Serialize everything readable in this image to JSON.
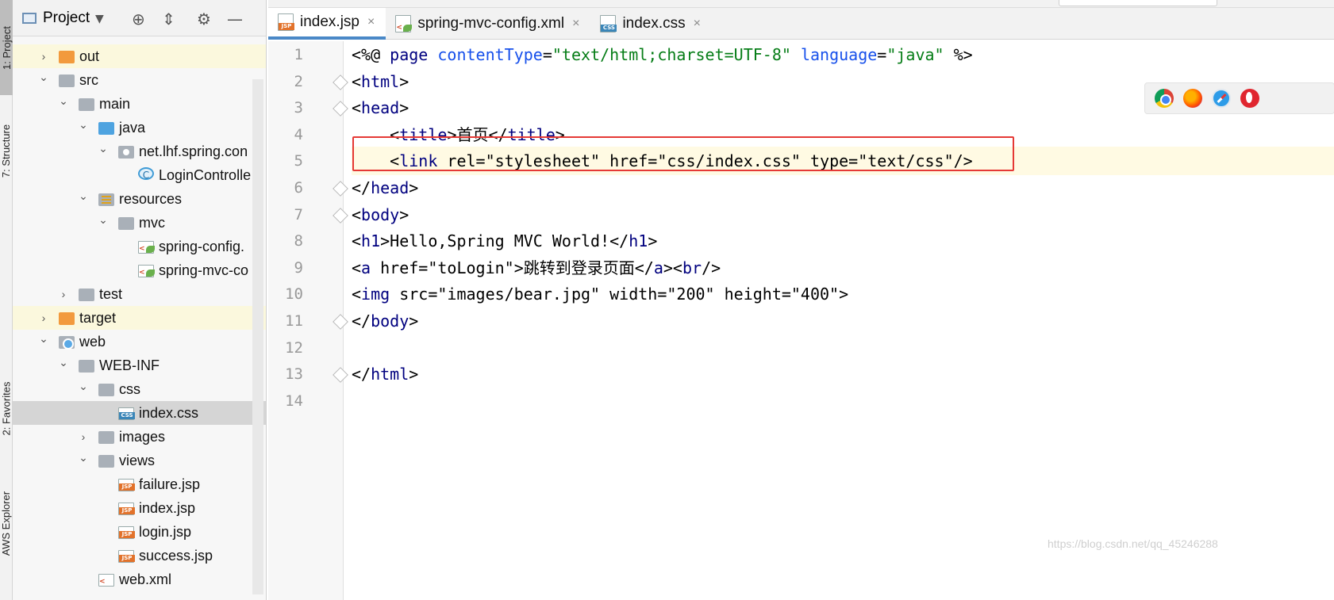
{
  "side_strip": {
    "tab_project": "1: Project",
    "tab_structure": "7: Structure",
    "tab_favorites": "2: Favorites",
    "tab_aws": "AWS Explorer"
  },
  "project_panel": {
    "title": "Project",
    "tree": [
      {
        "label": "out",
        "type": "folder-orange",
        "depth": 1,
        "expanded": false
      },
      {
        "label": "src",
        "type": "folder",
        "depth": 1,
        "expanded": true
      },
      {
        "label": "main",
        "type": "folder",
        "depth": 2,
        "expanded": true
      },
      {
        "label": "java",
        "type": "folder-blue",
        "depth": 3,
        "expanded": true
      },
      {
        "label": "net.lhf.spring.con",
        "type": "package",
        "depth": 4,
        "expanded": true
      },
      {
        "label": "LoginControlle",
        "type": "class",
        "depth": 5
      },
      {
        "label": "resources",
        "type": "folder-resources",
        "depth": 3,
        "expanded": true
      },
      {
        "label": "mvc",
        "type": "folder",
        "depth": 4,
        "expanded": true
      },
      {
        "label": "spring-config.",
        "type": "xml-spring",
        "depth": 5
      },
      {
        "label": "spring-mvc-co",
        "type": "xml-spring",
        "depth": 5
      },
      {
        "label": "test",
        "type": "folder",
        "depth": 2,
        "expanded": false
      },
      {
        "label": "target",
        "type": "folder-orange",
        "depth": 1,
        "expanded": false
      },
      {
        "label": "web",
        "type": "folder-web",
        "depth": 1,
        "expanded": true
      },
      {
        "label": "WEB-INF",
        "type": "folder",
        "depth": 2,
        "expanded": true
      },
      {
        "label": "css",
        "type": "folder",
        "depth": 3,
        "expanded": true
      },
      {
        "label": "index.css",
        "type": "css",
        "depth": 4,
        "selected": true
      },
      {
        "label": "images",
        "type": "folder",
        "depth": 3,
        "expanded": false
      },
      {
        "label": "views",
        "type": "folder",
        "depth": 3,
        "expanded": true
      },
      {
        "label": "failure.jsp",
        "type": "jsp",
        "depth": 4
      },
      {
        "label": "index.jsp",
        "type": "jsp",
        "depth": 4
      },
      {
        "label": "login.jsp",
        "type": "jsp",
        "depth": 4
      },
      {
        "label": "success.jsp",
        "type": "jsp",
        "depth": 4
      },
      {
        "label": "web.xml",
        "type": "xml",
        "depth": 3
      }
    ]
  },
  "editor": {
    "tabs": [
      {
        "label": "index.jsp",
        "kind": "jsp",
        "active": true
      },
      {
        "label": "spring-mvc-config.xml",
        "kind": "xml-spring",
        "active": false
      },
      {
        "label": "index.css",
        "kind": "css",
        "active": false
      }
    ],
    "close_glyph": "×",
    "line_numbers": [
      "1",
      "2",
      "3",
      "4",
      "5",
      "6",
      "7",
      "8",
      "9",
      "10",
      "11",
      "12",
      "13",
      "14"
    ],
    "current_line": 5,
    "code_lines": [
      "<%@ page contentType=\"text/html;charset=UTF-8\" language=\"java\" %>",
      "<html>",
      "<head>",
      "    <title>首页</title>",
      "    <link rel=\"stylesheet\" href=\"css/index.css\" type=\"text/css\"/>",
      "</head>",
      "<body>",
      "<h1>Hello,Spring MVC World!</h1>",
      "<a href=\"toLogin\">跳转到登录页面</a><br/>",
      "<img src=\"images/bear.jpg\" width=\"200\" height=\"400\">",
      "</body>",
      "",
      "</html>",
      ""
    ],
    "browser_icons": [
      "chrome-icon",
      "firefox-icon",
      "safari-icon",
      "opera-icon"
    ]
  },
  "watermark": "https://blog.csdn.net/qq_45246288",
  "colors": {
    "tag": "#00007f",
    "attribute": "#1750eb",
    "string": "#067d17",
    "highlight_box": "#e53935",
    "active_tab_underline": "#4a88c7"
  }
}
